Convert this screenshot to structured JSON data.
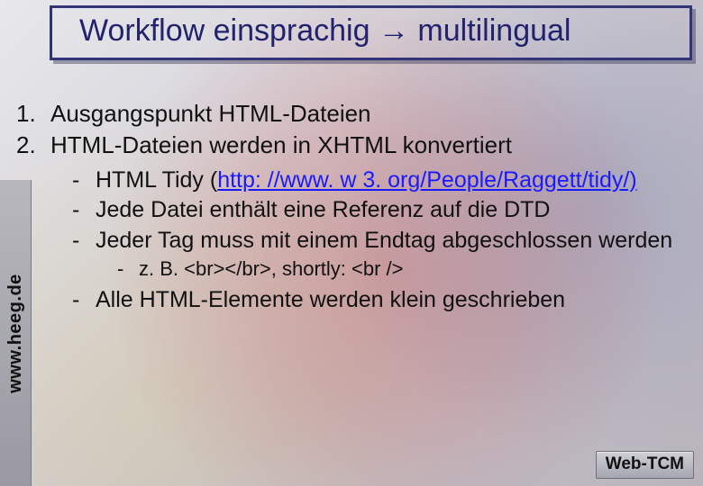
{
  "title": "Workflow einsprachig → multilingual",
  "sidebar": {
    "text": "www.heeg.de"
  },
  "list": {
    "items": [
      {
        "num": "1.",
        "text": "Ausgangspunkt HTML-Dateien"
      },
      {
        "num": "2.",
        "text": "HTML-Dateien werden in XHTML konvertiert"
      }
    ]
  },
  "sub1_a": {
    "items": [
      {
        "bullet": "-",
        "pre": "HTML Tidy (",
        "link": "http: //www. w 3. org/People/Raggett/tidy/)",
        "post": ""
      },
      {
        "bullet": "-",
        "text": "Jede Datei enthält eine Referenz auf die DTD"
      },
      {
        "bullet": "-",
        "text": "Jeder Tag muss mit einem Endtag abgeschlossen werden"
      }
    ]
  },
  "sub2": {
    "items": [
      {
        "bullet": "-",
        "text": "z. B. <br></br>, shortly: <br />"
      }
    ]
  },
  "sub1_b": {
    "items": [
      {
        "bullet": "-",
        "text": "Alle HTML-Elemente werden klein geschrieben"
      }
    ]
  },
  "footer": {
    "label": "Web-TCM"
  }
}
